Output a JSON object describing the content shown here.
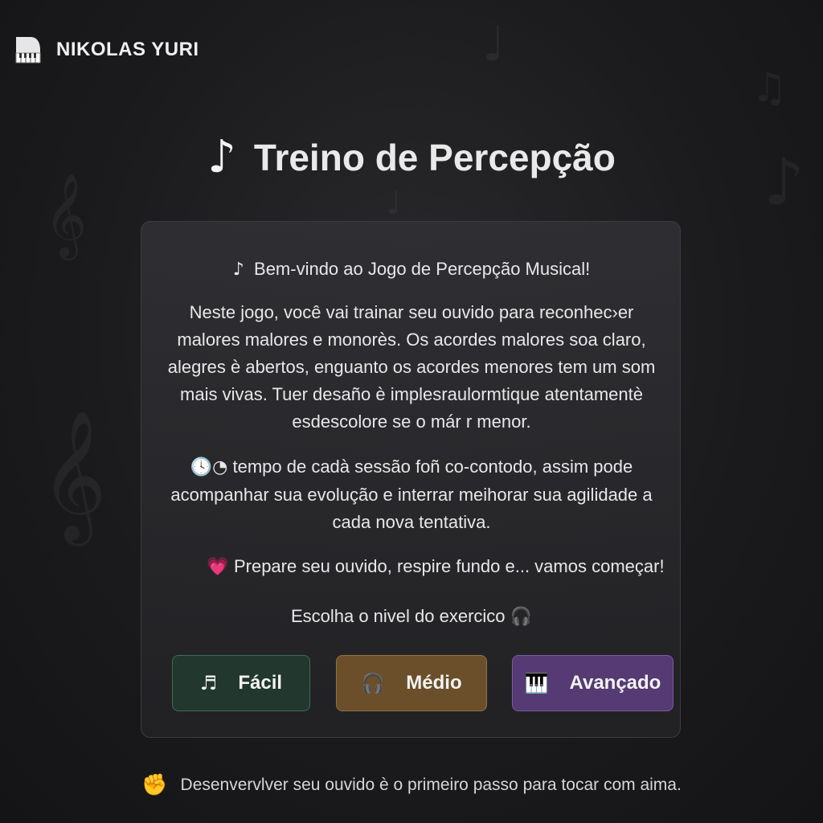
{
  "brand": {
    "name": "NIKOLAS YURI",
    "icon": "piano-icon"
  },
  "title": {
    "icon": "♪",
    "text": "Treino de Percepção"
  },
  "card": {
    "welcome_icon": "♪",
    "welcome": "Bem-vindo ao Jogo de Percepção Musical!",
    "intro": "Neste jogo, você vai trainar seu ouvido para reconhec›er malores malores e monorès. Os acordes malores soa claro, alegres è abertos, enguanto os acordes menores tem um som mais vivas. Tuer desaño è implesraulormtique atentamentè esdescolore se o már r menor.",
    "session_icon": "🕓◔",
    "session": "tempo de cadà sessão foñ co-contodo, assim pode acompanhar sua evolução e interrar meihorar sua agilidade a cada nova tentativa.",
    "ready_icon": "💗",
    "ready": "Prepare seu ouvido, respire fundo e... vamos começar!",
    "choose": "Escolha o nivel do exercico",
    "choose_icon": "🎧"
  },
  "levels": [
    {
      "label": "Fácil",
      "icon": "♬",
      "color": "#22372d"
    },
    {
      "label": "Médio",
      "icon": "🎧",
      "color": "#6a4f2a"
    },
    {
      "label": "Avançado",
      "icon": "🎹",
      "color": "#553a73"
    }
  ],
  "footer": {
    "icon": "✊",
    "text": "Desenvervlver seu ouvido è o primeiro passo para tocar com aima."
  }
}
